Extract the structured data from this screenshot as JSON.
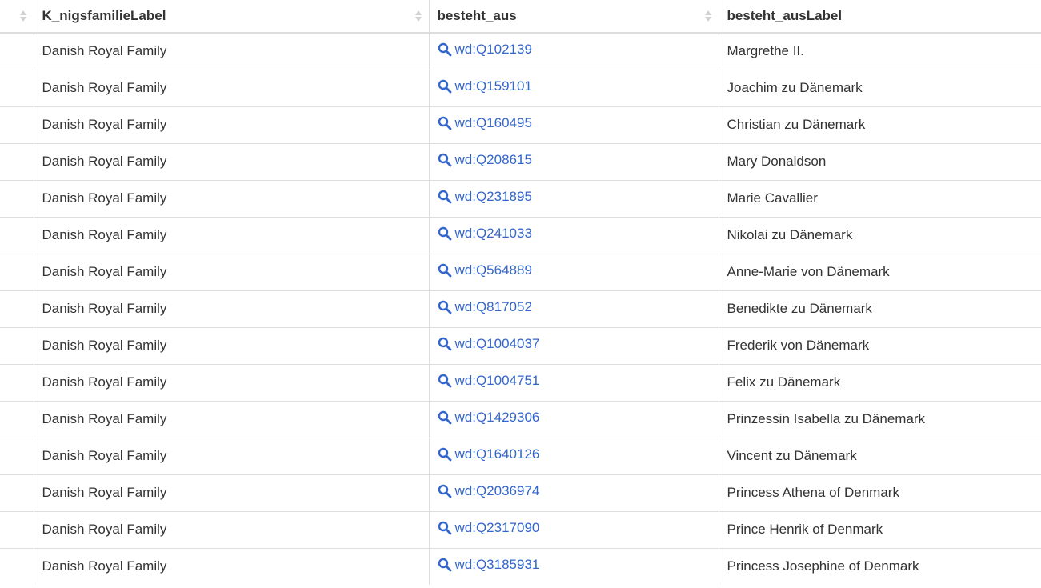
{
  "columns": [
    "",
    "K_nigsfamilieLabel",
    "besteht_aus",
    "besteht_ausLabel"
  ],
  "rows": [
    {
      "family": "Danish Royal Family",
      "id": "wd:Q102139",
      "label": "Margrethe II."
    },
    {
      "family": "Danish Royal Family",
      "id": "wd:Q159101",
      "label": "Joachim zu Dänemark"
    },
    {
      "family": "Danish Royal Family",
      "id": "wd:Q160495",
      "label": "Christian zu Dänemark"
    },
    {
      "family": "Danish Royal Family",
      "id": "wd:Q208615",
      "label": "Mary Donaldson"
    },
    {
      "family": "Danish Royal Family",
      "id": "wd:Q231895",
      "label": "Marie Cavallier"
    },
    {
      "family": "Danish Royal Family",
      "id": "wd:Q241033",
      "label": "Nikolai zu Dänemark"
    },
    {
      "family": "Danish Royal Family",
      "id": "wd:Q564889",
      "label": "Anne-Marie von Dänemark"
    },
    {
      "family": "Danish Royal Family",
      "id": "wd:Q817052",
      "label": "Benedikte zu Dänemark"
    },
    {
      "family": "Danish Royal Family",
      "id": "wd:Q1004037",
      "label": "Frederik von Dänemark"
    },
    {
      "family": "Danish Royal Family",
      "id": "wd:Q1004751",
      "label": "Felix zu Dänemark"
    },
    {
      "family": "Danish Royal Family",
      "id": "wd:Q1429306",
      "label": "Prinzessin Isabella zu Dänemark"
    },
    {
      "family": "Danish Royal Family",
      "id": "wd:Q1640126",
      "label": "Vincent zu Dänemark"
    },
    {
      "family": "Danish Royal Family",
      "id": "wd:Q2036974",
      "label": "Princess Athena of Denmark"
    },
    {
      "family": "Danish Royal Family",
      "id": "wd:Q2317090",
      "label": "Prince Henrik of Denmark"
    },
    {
      "family": "Danish Royal Family",
      "id": "wd:Q3185931",
      "label": "Princess Josephine of Denmark"
    }
  ],
  "icons": {
    "link_icon": "search-icon",
    "sort_icon": "sort-both-icon"
  },
  "colors": {
    "link": "#3366cc",
    "text": "#333333",
    "border": "#dddddd"
  }
}
